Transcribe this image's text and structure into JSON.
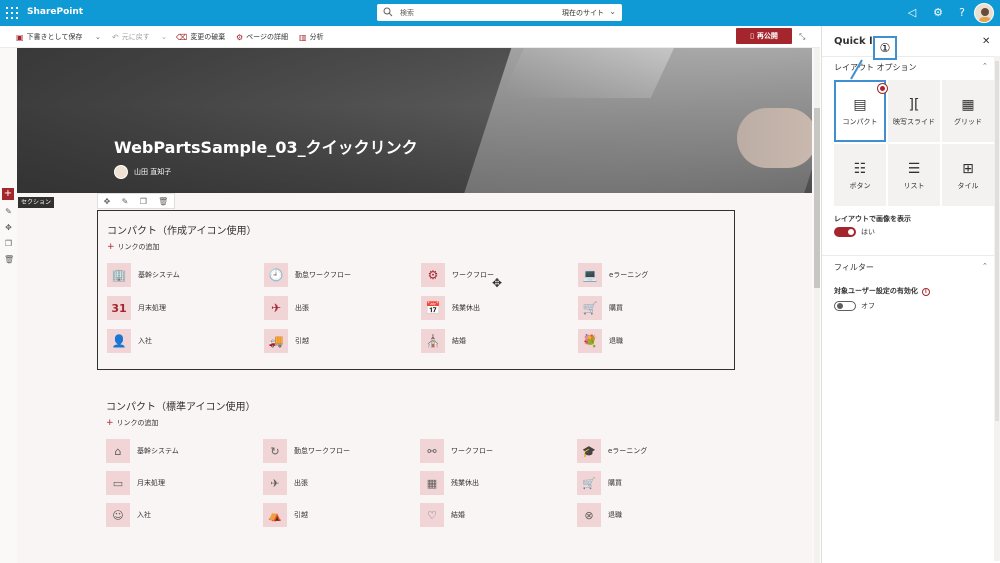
{
  "suitebar": {
    "brand": "SharePoint",
    "search_placeholder": "検索",
    "search_scope": "現在のサイト",
    "icons": [
      "waffle-icon",
      "megaphone-icon",
      "gear-icon",
      "help-icon",
      "avatar"
    ],
    "color": "#0f9ad6"
  },
  "commandbar": {
    "save_draft": "下書きとして保存",
    "undo": "元に戻す",
    "discard": "変更の破棄",
    "page_details": "ページの詳細",
    "analytics": "分析",
    "republish": "再公開"
  },
  "hero": {
    "title": "WebPartsSample_03_クイックリンク",
    "author": "山田 直知子"
  },
  "section_tag": "セクション",
  "quicklinks_custom": {
    "title": "コンパクト（作成アイコン使用）",
    "add_link": "リンクの追加",
    "items": [
      {
        "label": "基幹システム",
        "icon": "🏢"
      },
      {
        "label": "勤怠ワークフロー",
        "icon": "🕘"
      },
      {
        "label": "ワークフロー",
        "icon": "⚙"
      },
      {
        "label": "eラーニング",
        "icon": "💻"
      },
      {
        "label": "月末処理",
        "icon": "31"
      },
      {
        "label": "出張",
        "icon": "✈"
      },
      {
        "label": "残業休出",
        "icon": "📅"
      },
      {
        "label": "購買",
        "icon": "🛒"
      },
      {
        "label": "入社",
        "icon": "👤"
      },
      {
        "label": "引越",
        "icon": "🚚"
      },
      {
        "label": "結婚",
        "icon": "⛪"
      },
      {
        "label": "退職",
        "icon": "💐"
      }
    ]
  },
  "quicklinks_standard": {
    "title": "コンパクト（標準アイコン使用）",
    "add_link": "リンクの追加",
    "items": [
      {
        "label": "基幹システム",
        "icon": "⌂"
      },
      {
        "label": "勤怠ワークフロー",
        "icon": "↻"
      },
      {
        "label": "ワークフロー",
        "icon": "⚯"
      },
      {
        "label": "eラーニング",
        "icon": "🎓"
      },
      {
        "label": "月末処理",
        "icon": "▭"
      },
      {
        "label": "出張",
        "icon": "✈"
      },
      {
        "label": "残業休出",
        "icon": "▦"
      },
      {
        "label": "購買",
        "icon": "🛒"
      },
      {
        "label": "入社",
        "icon": "☺"
      },
      {
        "label": "引越",
        "icon": "⛺"
      },
      {
        "label": "結婚",
        "icon": "♡"
      },
      {
        "label": "退職",
        "icon": "⊗"
      }
    ]
  },
  "pane": {
    "title": "Quick l",
    "callout": "①",
    "layout_section": "レイアウト オプション",
    "layouts": [
      {
        "label": "コンパクト",
        "icon": "▤",
        "selected": true
      },
      {
        "label": "映写スライド",
        "icon": "][",
        "selected": false
      },
      {
        "label": "グリッド",
        "icon": "▦",
        "selected": false
      },
      {
        "label": "ボタン",
        "icon": "☷",
        "selected": false
      },
      {
        "label": "リスト",
        "icon": "☰",
        "selected": false
      },
      {
        "label": "タイル",
        "icon": "⊞",
        "selected": false
      }
    ],
    "show_images_label": "レイアウトで画像を表示",
    "show_images_value": "はい",
    "filter_section": "フィルター",
    "audience_label": "対象ユーザー設定の有効化",
    "audience_value": "オフ",
    "accent": "#a4262c",
    "callout_color": "#3f8fd1"
  }
}
